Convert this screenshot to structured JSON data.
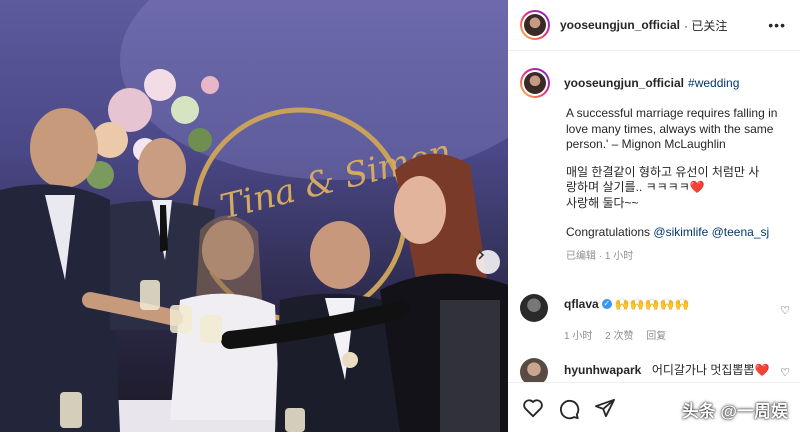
{
  "post": {
    "username": "yooseungjun_official",
    "follow_status": "· 已关注",
    "more_icon": "more-horizontal-icon",
    "photo_sign_text": "Tina & Simon"
  },
  "caption": {
    "username": "yooseungjun_official",
    "hashtag": "#wedding",
    "line1": "A successful marriage requires falling in",
    "line2": "love many times, always with the same",
    "line3": "person.' – Mignon McLaughlin",
    "kor1": "매일 한결같이 형하고 유선이 처럼만 사",
    "kor2": "랑하며 살기를.. ㅋㅋㅋㅋ",
    "kor2_emoji": "❤️",
    "kor3": "사랑해 둘다~~",
    "congrats": "Congratulations",
    "mention1": "@sikimlife",
    "mention2": "@teena_sj",
    "edited": "已编辑",
    "time": "· 1 小时"
  },
  "comments": [
    {
      "username": "qflava",
      "text": "🙌🙌🙌🙌🙌",
      "time": "1 小时",
      "likes": "2 次赞",
      "reply": "回复"
    },
    {
      "username": "hyunhwapark",
      "text": "어디갈가나 멋집뽑뽑",
      "emoji": "❤️"
    }
  ],
  "actions": {
    "like_icon": "heart-icon",
    "comment_icon": "comment-icon",
    "share_icon": "paper-plane-icon",
    "watermark": "头条 @一周娱"
  },
  "colors": {
    "link": "#00376b",
    "verified": "#3897f0",
    "muted": "#8e8e8e"
  }
}
